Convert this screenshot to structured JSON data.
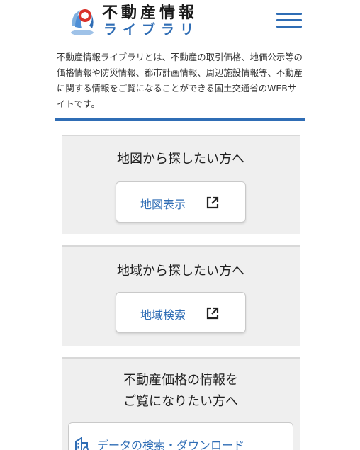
{
  "header": {
    "logo_line1": "不動産情報",
    "logo_line2": "ライブラリ",
    "menu_icon": "hamburger-menu-icon"
  },
  "intro": {
    "text": "不動産情報ライブラリとは、不動産の取引価格、地価公示等の価格情報や防災情報、都市計画情報、周辺施設情報等、不動産に関する情報をご覧になることができる国土交通省のWEBサイトです。"
  },
  "sections": [
    {
      "heading": "地図から探したい方へ",
      "button_label": "地図表示",
      "button_icon": "external-link-icon"
    },
    {
      "heading": "地域から探したい方へ",
      "button_label": "地域検索",
      "button_icon": "external-link-icon"
    },
    {
      "heading_line1": "不動産価格の情報を",
      "heading_line2": "ご覧になりたい方へ",
      "button_label": "データの検索・ダウンロード",
      "button_icon": "building-search-icon"
    }
  ],
  "colors": {
    "accent": "#2f6db5",
    "section_bg": "#efefef",
    "logo_red": "#d9322b"
  }
}
